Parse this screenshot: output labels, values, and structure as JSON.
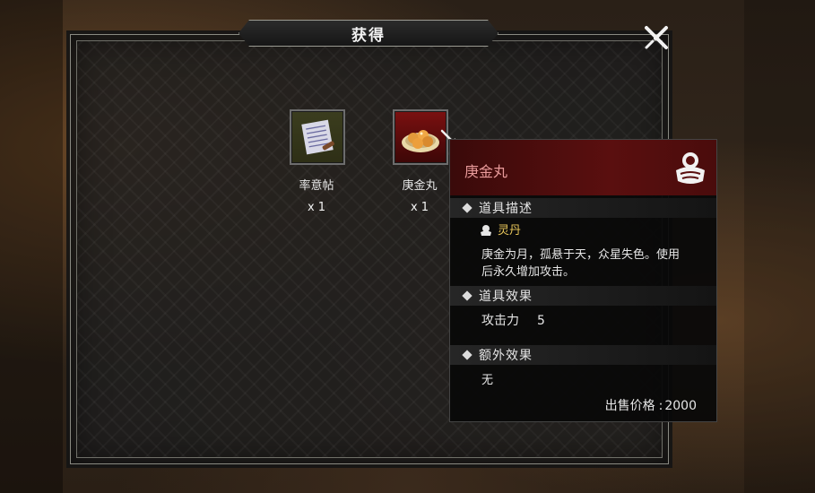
{
  "window": {
    "title": "获得"
  },
  "items": [
    {
      "name": "率意帖",
      "quantity": "x 1",
      "icon": "scroll-icon"
    },
    {
      "name": "庚金丸",
      "quantity": "x 1",
      "icon": "pill-dish-icon"
    }
  ],
  "tooltip": {
    "item_name": "庚金丸",
    "section_description": "道具描述",
    "category": "灵丹",
    "description": "庚金为月，孤悬于天，众星失色。使用后永久增加攻击。",
    "section_effect": "道具效果",
    "effect_label": "攻击力",
    "effect_value": "5",
    "section_extra": "额外效果",
    "extra_value": "无",
    "price_label": "出售价格",
    "price_value": "2000"
  },
  "colors": {
    "item_name_red": "#e89a9a",
    "category_gold": "#e8c65a",
    "tooltip_header": "#5a0f0f"
  }
}
